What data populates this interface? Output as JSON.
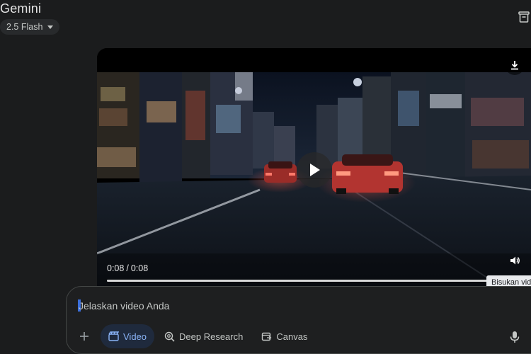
{
  "app": {
    "title": "Gemini"
  },
  "model": {
    "selected": "2.5 Flash"
  },
  "video": {
    "current_time": "0:08",
    "duration": "0:08",
    "separator": "/",
    "progress": 1.0,
    "tooltip": "Bisukan video"
  },
  "composer": {
    "placeholder": "Jelaskan video Anda",
    "tools": [
      {
        "label": "Video",
        "icon": "video-clapper-icon",
        "active": true
      },
      {
        "label": "Deep Research",
        "icon": "deep-research-icon",
        "active": false
      },
      {
        "label": "Canvas",
        "icon": "canvas-icon",
        "active": false
      }
    ]
  },
  "colors": {
    "background": "#1b1c1d",
    "active_chip_bg": "#1f2a3d",
    "active_chip_text": "#8ab4f8",
    "caret": "#3b6fdc"
  }
}
